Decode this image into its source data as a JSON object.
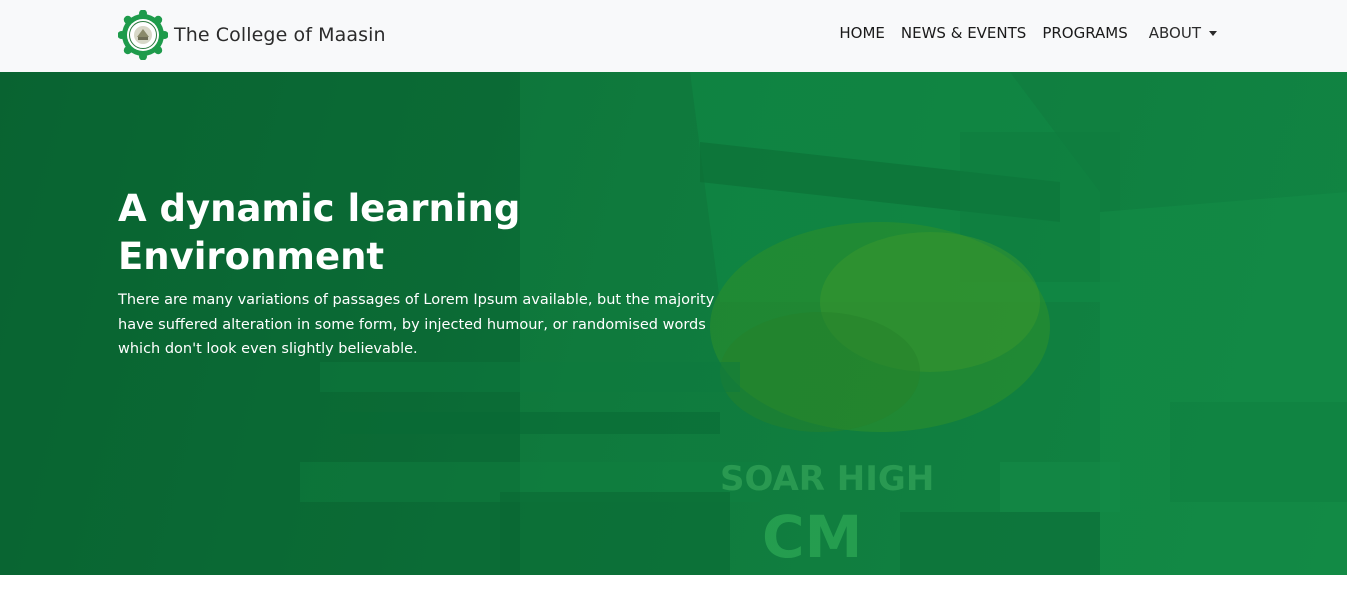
{
  "navbar": {
    "brand_name": "The College of Maasin",
    "logo_icon": "college-seal-logo",
    "links": [
      {
        "label": "HOME"
      },
      {
        "label": "NEWS & EVENTS"
      },
      {
        "label": "PROGRAMS"
      },
      {
        "label": "ABOUT"
      }
    ]
  },
  "hero": {
    "title": "A dynamic learning Environment",
    "text": "There are many variations of passages of Lorem Ipsum available, but the majority have suffered alteration in some form, by injected humour, or randomised words which don't look even slightly believable.",
    "sign_text_line1": "SOAR HIGH",
    "sign_text_line2": "CM"
  },
  "colors": {
    "brand_green": "#0f7a3d",
    "navbar_bg": "#f8f9fa"
  }
}
